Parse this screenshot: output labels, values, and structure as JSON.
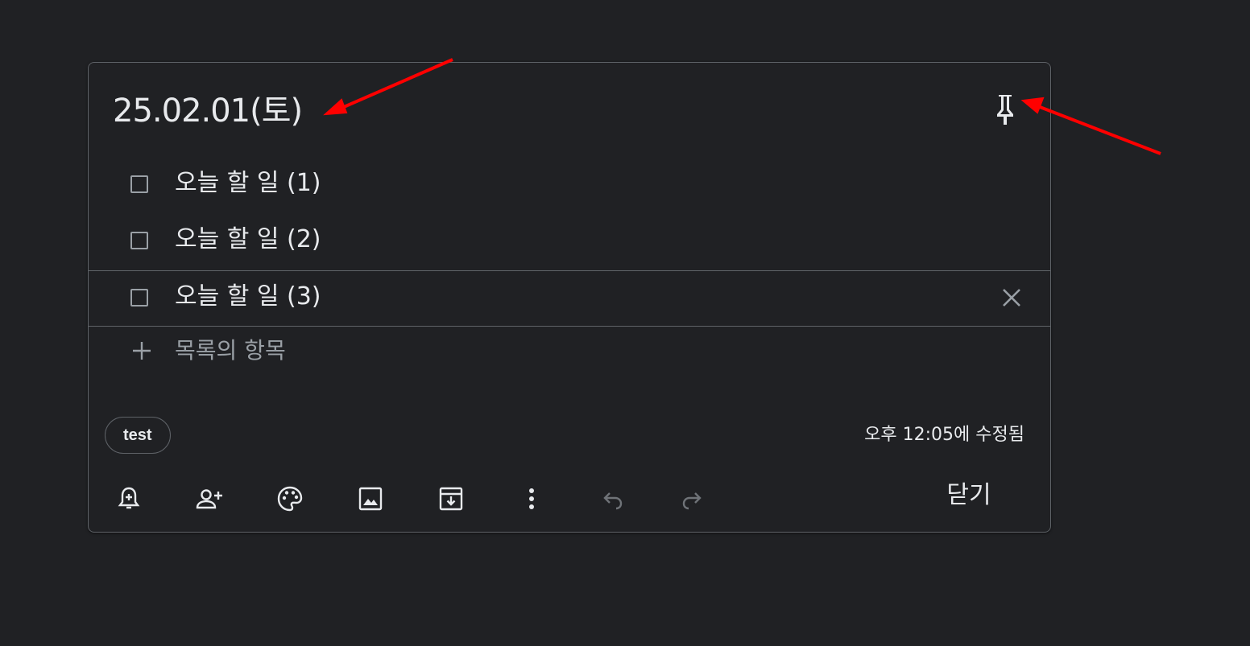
{
  "note": {
    "title": "25.02.01(토)",
    "items": [
      {
        "label": "오늘 할 일 (1)",
        "checked": false
      },
      {
        "label": "오늘 할 일 (2)",
        "checked": false
      },
      {
        "label": "오늘 할 일 (3)",
        "checked": false
      }
    ],
    "add_item_label": "목록의 항목",
    "label_chip": "test",
    "edited_text": "오후 12:05에 수정됨",
    "close_label": "닫기"
  },
  "icons": {
    "pin": "pin-icon",
    "remind": "bell-plus-icon",
    "collaborator": "person-add-icon",
    "palette": "palette-icon",
    "image": "image-icon",
    "archive": "archive-icon",
    "more": "more-vert-icon",
    "undo": "undo-icon",
    "redo": "redo-icon",
    "delete": "close-icon",
    "add": "plus-icon"
  },
  "colors": {
    "background": "#202124",
    "border": "#5f6368",
    "text": "#e8eaed",
    "muted": "#9aa0a6",
    "annotation_arrow": "#ff0000"
  }
}
